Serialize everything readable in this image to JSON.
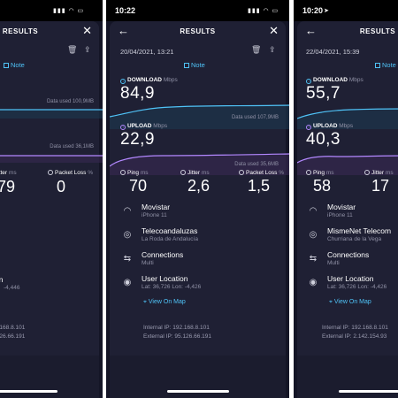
{
  "title": "RESULTS",
  "note_label": "Note",
  "download_label": "DOWNLOAD",
  "upload_label": "UPLOAD",
  "speed_unit": "Mbps",
  "data_used_prefix": "Data used",
  "ping_label": "Ping",
  "jitter_label": "Jitter",
  "ms_unit": "ms",
  "packet_loss_label": "Packet Loss",
  "percent_unit": "%",
  "view_on_map": "View On Map",
  "provider_row_label": "Connections",
  "connections_value": "Multi",
  "location_label": "User Location",
  "colors": {
    "download": "#4fc3f7",
    "upload": "#b388ff",
    "background": "#1f2034"
  },
  "left": {
    "download_data_used": "Data used 100,9MB",
    "upload_data_used": "Data used 36,1MB",
    "jitter": ",79",
    "packet_loss": "0",
    "connections_partial": "s",
    "location_partial": "on",
    "lon_partial": "-4,446",
    "map_partial": "p",
    "ip_internal": "2.168.8.101",
    "ip_external": ".126.66.191"
  },
  "middle": {
    "time": "10:22",
    "date": "20/04/2021, 13:21",
    "download": "84,9",
    "download_data_used": "Data used 107,9MB",
    "upload": "22,9",
    "upload_data_used": "Data used 35,6MB",
    "ping": "70",
    "jitter": "2,6",
    "packet_loss": "1,5",
    "carrier": "Movistar",
    "device": "iPhone 11",
    "server": "Telecoandaluzas",
    "server_location": "La Roda de Andalucía",
    "lat_lon": "Lat: 36,726   Lon: -4,426",
    "internal_ip": "Internal IP: 192.168.8.101",
    "external_ip": "External IP: 95.126.66.191"
  },
  "right": {
    "time": "10:20",
    "date": "22/04/2021, 15:39",
    "download": "55,7",
    "upload": "40,3",
    "ping": "58",
    "jitter": "17",
    "carrier": "Movistar",
    "device": "iPhone 11",
    "server": "MismeNet Telecom",
    "server_location": "Churriana de la Vega",
    "lat_lon": "Lat: 36,726   Lon: -4,426",
    "internal_ip": "Internal IP: 192.168.8.101",
    "external_ip": "External IP: 2.142.154.93"
  }
}
